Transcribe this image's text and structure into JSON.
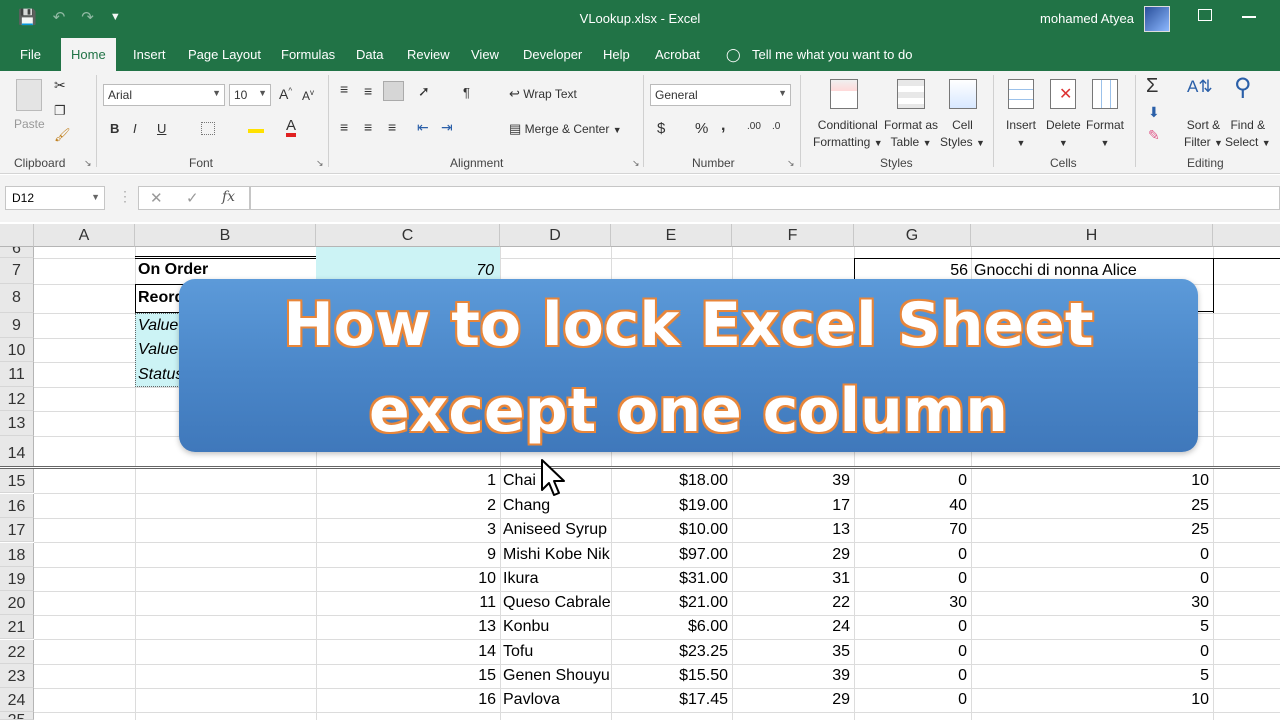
{
  "titlebar": {
    "document_title": "VLookup.xlsx  -  Excel",
    "user_name": "mohamed Atyea"
  },
  "tabs": [
    "File",
    "Home",
    "Insert",
    "Page Layout",
    "Formulas",
    "Data",
    "Review",
    "View",
    "Developer",
    "Help",
    "Acrobat"
  ],
  "tell_me": "Tell me what you want to do",
  "ribbon": {
    "clipboard": {
      "paste": "Paste",
      "label": "Clipboard"
    },
    "font": {
      "family": "Arial",
      "size": "10",
      "bold": "B",
      "italic": "I",
      "underline": "U",
      "label": "Font"
    },
    "alignment": {
      "wrap_text": "Wrap Text",
      "merge_center": "Merge & Center",
      "label": "Alignment"
    },
    "number": {
      "format": "General",
      "currency": "$",
      "percent": "%",
      "comma": ",",
      "label": "Number"
    },
    "styles": {
      "conditional_formatting": [
        "Conditional",
        "Formatting"
      ],
      "format_as_table": [
        "Format as",
        "Table"
      ],
      "cell_styles": [
        "Cell",
        "Styles"
      ],
      "label": "Styles"
    },
    "cells": {
      "insert": "Insert",
      "delete": "Delete",
      "format": "Format",
      "label": "Cells"
    },
    "editing": {
      "sort_filter": [
        "Sort &",
        "Filter"
      ],
      "find_select": [
        "Find &",
        "Select"
      ],
      "label": "Editing"
    }
  },
  "formula_bar": {
    "name_box": "D12",
    "fx": "fx",
    "formula": ""
  },
  "columns": [
    "A",
    "B",
    "C",
    "D",
    "E",
    "F",
    "G",
    "H"
  ],
  "rows": [
    "6",
    "7",
    "8",
    "9",
    "10",
    "11",
    "12",
    "13",
    "14",
    "15",
    "16",
    "17",
    "18",
    "19",
    "20",
    "21",
    "22",
    "23",
    "24",
    "25"
  ],
  "top_cells": {
    "b7": "On Order",
    "c7": "70",
    "b8": "Reorder Level",
    "b9": "Value",
    "b10": "Value",
    "b11": "Status",
    "g7": "56",
    "h7": "Gnocchi di nonna Alice"
  },
  "table": [
    {
      "id": "1",
      "name": "Chai",
      "price": "$18.00",
      "stock": "39",
      "order": "0",
      "reorder": "10"
    },
    {
      "id": "2",
      "name": "Chang",
      "price": "$19.00",
      "stock": "17",
      "order": "40",
      "reorder": "25"
    },
    {
      "id": "3",
      "name": "Aniseed Syrup",
      "price": "$10.00",
      "stock": "13",
      "order": "70",
      "reorder": "25"
    },
    {
      "id": "9",
      "name": "Mishi Kobe Niku",
      "price": "$97.00",
      "stock": "29",
      "order": "0",
      "reorder": "0"
    },
    {
      "id": "10",
      "name": "Ikura",
      "price": "$31.00",
      "stock": "31",
      "order": "0",
      "reorder": "0"
    },
    {
      "id": "11",
      "name": "Queso Cabrales",
      "price": "$21.00",
      "stock": "22",
      "order": "30",
      "reorder": "30"
    },
    {
      "id": "13",
      "name": "Konbu",
      "price": "$6.00",
      "stock": "24",
      "order": "0",
      "reorder": "5"
    },
    {
      "id": "14",
      "name": "Tofu",
      "price": "$23.25",
      "stock": "35",
      "order": "0",
      "reorder": "0"
    },
    {
      "id": "15",
      "name": "Genen Shouyu",
      "price": "$15.50",
      "stock": "39",
      "order": "0",
      "reorder": "5"
    },
    {
      "id": "16",
      "name": "Pavlova",
      "price": "$17.45",
      "stock": "29",
      "order": "0",
      "reorder": "10"
    }
  ],
  "banner": {
    "line1": "How to lock Excel Sheet",
    "line2": "except one column"
  },
  "colors": {
    "excel_green": "#217346",
    "banner_blue": "#4a86c8",
    "banner_outline": "#e8863a"
  }
}
